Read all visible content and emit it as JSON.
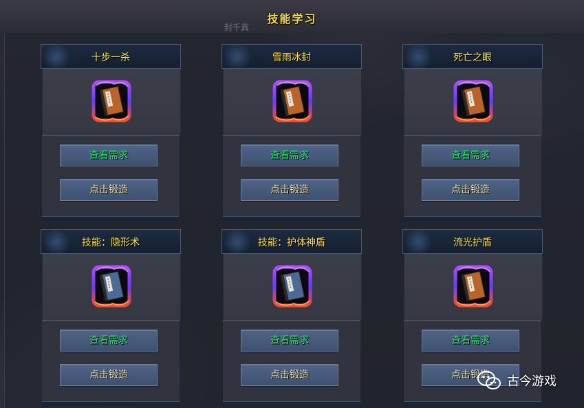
{
  "window": {
    "title": "技能学习",
    "subtitle": "封千真"
  },
  "cards": [
    {
      "title": "十步一杀",
      "book_color": "#b8642a",
      "req_label": "查看需求",
      "forge_label": "点击锻造"
    },
    {
      "title": "雪雨冰封",
      "book_color": "#b8642a",
      "req_label": "查看需求",
      "forge_label": "点击锻造"
    },
    {
      "title": "死亡之眼",
      "book_color": "#b8642a",
      "req_label": "查看需求",
      "forge_label": "点击锻造"
    },
    {
      "title": "技能：隐形术",
      "book_color": "#4a6a9a",
      "req_label": "查看需求",
      "forge_label": "点击锻造"
    },
    {
      "title": "技能：护体神盾",
      "book_color": "#4a6a9a",
      "req_label": "查看需求",
      "forge_label": "点击锻造"
    },
    {
      "title": "流光护盾",
      "book_color": "#b8642a",
      "req_label": "查看需求",
      "forge_label": "点击锻造"
    }
  ],
  "watermark": {
    "text": "古今游戏",
    "icon": "wechat-icon"
  },
  "colors": {
    "title_gold": "#ffe24a",
    "requirement_green": "#2fe07a",
    "button_blue": "#4f6487"
  }
}
